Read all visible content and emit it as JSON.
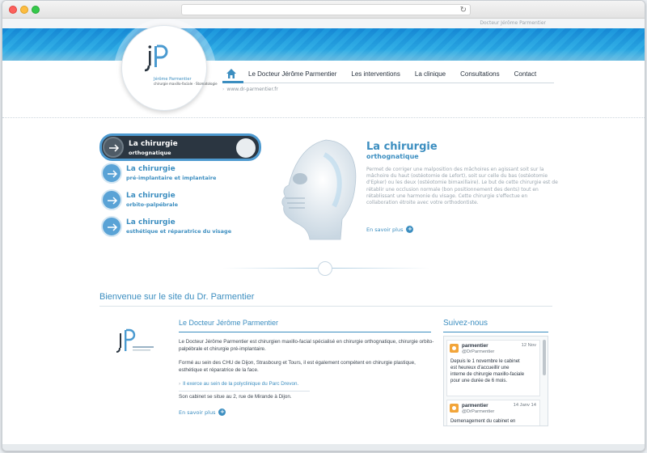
{
  "browser": {
    "reload_icon": "reload-icon"
  },
  "site": {
    "top_name": "Docteur Jérôme Parmentier",
    "logo": {
      "initials": "jP",
      "name": "Jérôme Parmentier",
      "subtitle": "chirurgie maxillo-faciale · Stomatologie"
    },
    "breadcrumb": "www.dr-parmentier.fr"
  },
  "nav": {
    "home_icon": "home-icon",
    "items": [
      {
        "label": "Le Docteur Jérôme Parmentier"
      },
      {
        "label": "Les interventions"
      },
      {
        "label": "La clinique"
      },
      {
        "label": "Consultations"
      },
      {
        "label": "Contact"
      }
    ]
  },
  "features": {
    "menu": [
      {
        "title": "La chirurgie",
        "subtitle": "orthognatique",
        "active": true
      },
      {
        "title": "La chirurgie",
        "subtitle": "pré-implantaire et implantaire",
        "active": false
      },
      {
        "title": "La chirurgie",
        "subtitle": "orbito-palpébrale",
        "active": false
      },
      {
        "title": "La chirurgie",
        "subtitle": "esthétique et réparatrice du visage",
        "active": false
      }
    ],
    "detail": {
      "title": "La chirurgie",
      "subtitle": "orthognatique",
      "text": "Permet de corriger une malposition des mâchoires en agissant soit sur la mâchoire du haut (ostéotomie de Lefort), soit sur celle du bas (ostéotomie d'Epker) ou les deux (ostéotomie bimaxillaire). Le but de cette chirurgie est de rétablir une occlusion normale (bon positionnement des dents) tout en rétablissant une harmonie du visage. Cette chirurgie s'effectue en collaboration étroite avec votre orthodontiste.",
      "more": "En savoir plus"
    }
  },
  "welcome": {
    "title": "Bienvenue sur le site du Dr. Parmentier",
    "doctor": {
      "title": "Le Docteur Jérôme Parmentier",
      "p1": "Le Docteur Jérôme Parmentier est chirurgien maxillo-facial spécialisé en chirurgie orthognatique, chirurgie orbito-palpébrale et chirurgie pré-implantaire.",
      "p2": "Formé au sein des CHU de Dijon, Strasbourg et Tours, il est également compétent en chirurgie plastique, esthétique et réparatrice de la face.",
      "link": "Il exerce au sein de la polyclinique du Parc Drevon.",
      "p3": "Son cabinet se situe au 2, rue de Mirande à Dijon.",
      "more": "En savoir plus"
    },
    "twitter": {
      "title": "Suivez-nous",
      "tweets": [
        {
          "name": "parmentier",
          "handle": "@DrParmentier",
          "date": "12 Nov",
          "text": "Depuis le 1 novembre le cabinet est heureux d'accueillir une interne de chirurgie maxillo-faciale pour une durée de 6 mois."
        },
        {
          "name": "parmentier",
          "handle": "@DrParmentier",
          "date": "14 Janv 14",
          "text": "Demenagement du cabinet en"
        }
      ]
    }
  }
}
